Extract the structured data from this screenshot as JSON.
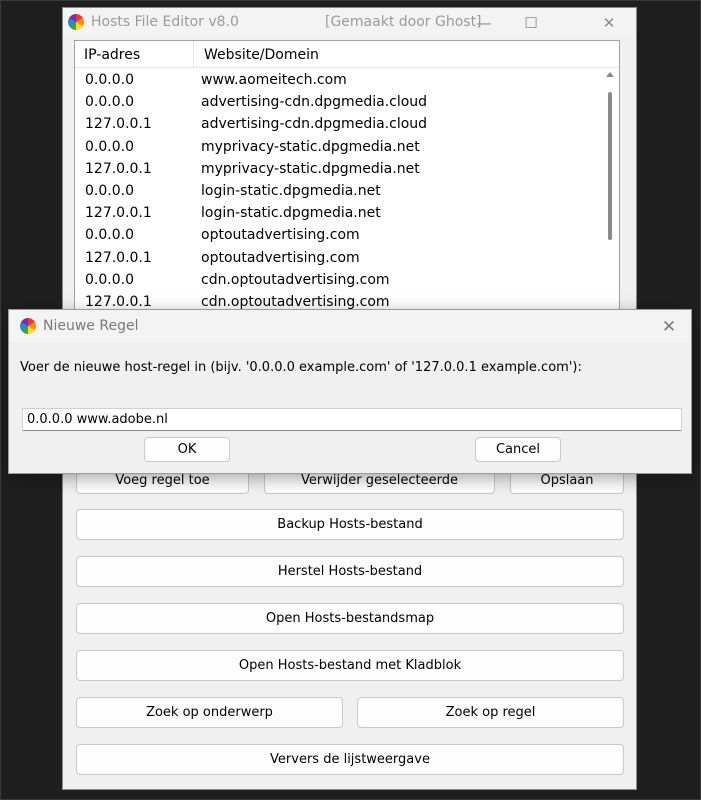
{
  "main_window": {
    "title": "Hosts File Editor v8.0",
    "credit": "[Gemaakt door Ghost]",
    "controls": {
      "minimize": "—",
      "maximize": "☐",
      "close": "✕"
    }
  },
  "list": {
    "columns": [
      "IP-adres",
      "Website/Domein"
    ],
    "rows": [
      {
        "ip": "0.0.0.0",
        "domain": "www.aomeitech.com"
      },
      {
        "ip": "0.0.0.0",
        "domain": "advertising-cdn.dpgmedia.cloud"
      },
      {
        "ip": "127.0.0.1",
        "domain": "advertising-cdn.dpgmedia.cloud"
      },
      {
        "ip": "0.0.0.0",
        "domain": "myprivacy-static.dpgmedia.net"
      },
      {
        "ip": "127.0.0.1",
        "domain": "myprivacy-static.dpgmedia.net"
      },
      {
        "ip": "0.0.0.0",
        "domain": "login-static.dpgmedia.net"
      },
      {
        "ip": "127.0.0.1",
        "domain": "login-static.dpgmedia.net"
      },
      {
        "ip": "0.0.0.0",
        "domain": "optoutadvertising.com"
      },
      {
        "ip": "127.0.0.1",
        "domain": "optoutadvertising.com"
      },
      {
        "ip": "0.0.0.0",
        "domain": "cdn.optoutadvertising.com"
      },
      {
        "ip": "127.0.0.1",
        "domain": "cdn.optoutadvertising.com"
      }
    ]
  },
  "buttons": {
    "add": "Voeg regel toe",
    "delete": "Verwijder geselecteerde",
    "save": "Opslaan",
    "backup": "Backup Hosts-bestand",
    "restore": "Herstel Hosts-bestand",
    "open_folder": "Open Hosts-bestandsmap",
    "open_notepad": "Open Hosts-bestand met Kladblok",
    "search_subject": "Zoek op onderwerp",
    "search_line": "Zoek op regel",
    "refresh": "Ververs de lijstweergave"
  },
  "dialog": {
    "title": "Nieuwe Regel",
    "close": "✕",
    "prompt": "Voer de nieuwe host-regel in (bijv. '0.0.0.0 example.com' of '127.0.0.1 example.com'):",
    "input_value": "0.0.0.0 www.adobe.nl",
    "ok": "OK",
    "cancel": "Cancel"
  }
}
